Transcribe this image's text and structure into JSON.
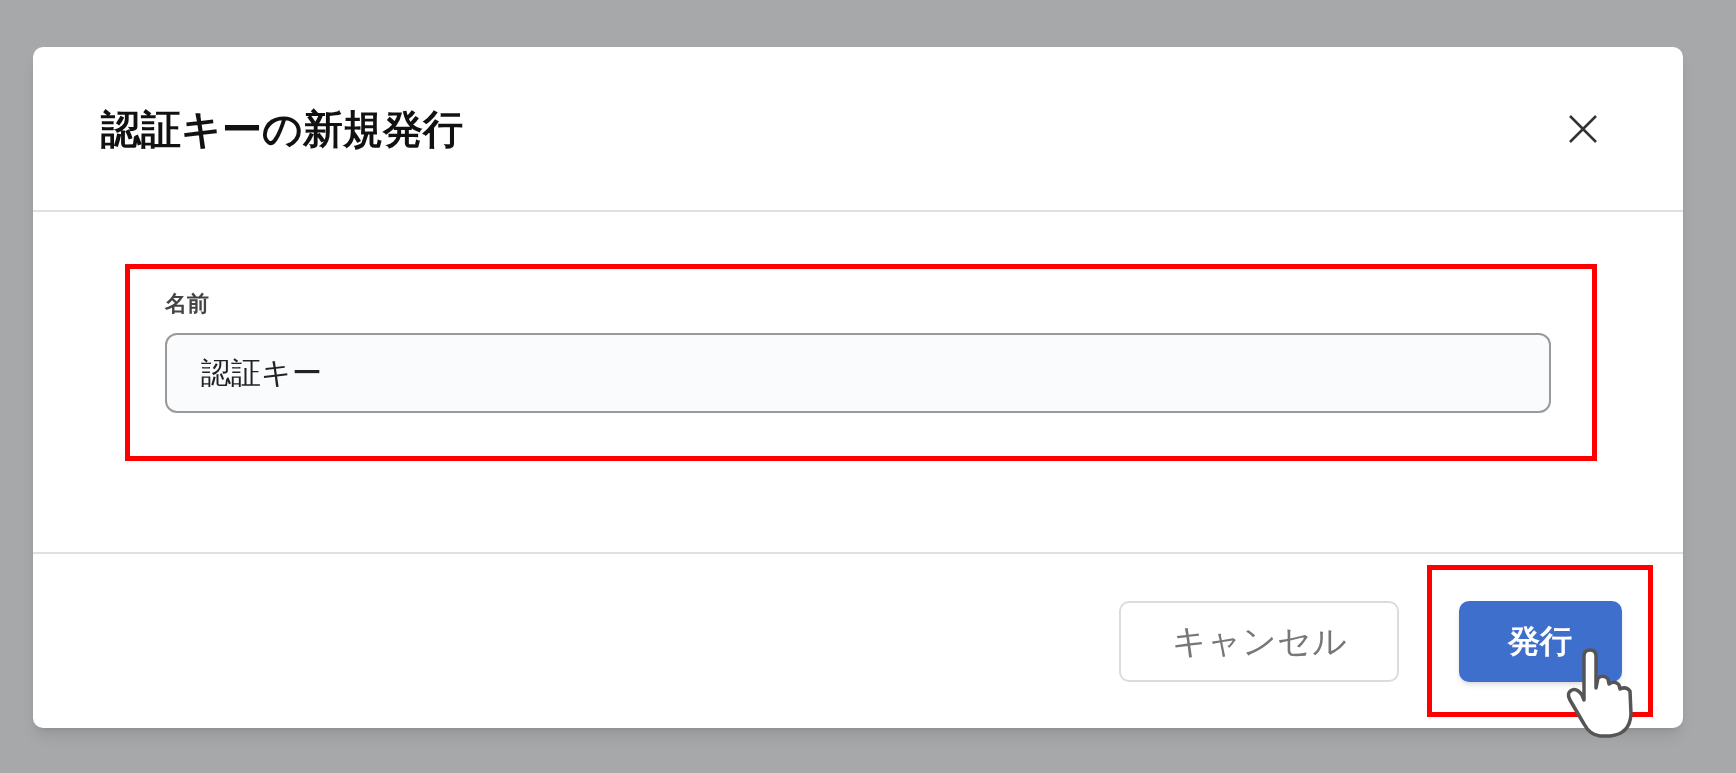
{
  "dialog": {
    "title": "認証キーの新規発行",
    "field": {
      "label": "名前",
      "value": "認証キー",
      "highlighted": true
    },
    "buttons": [
      {
        "label": "キャンセル",
        "kind": "secondary",
        "highlighted": false
      },
      {
        "label": "発行",
        "kind": "primary",
        "highlighted": true
      }
    ]
  }
}
